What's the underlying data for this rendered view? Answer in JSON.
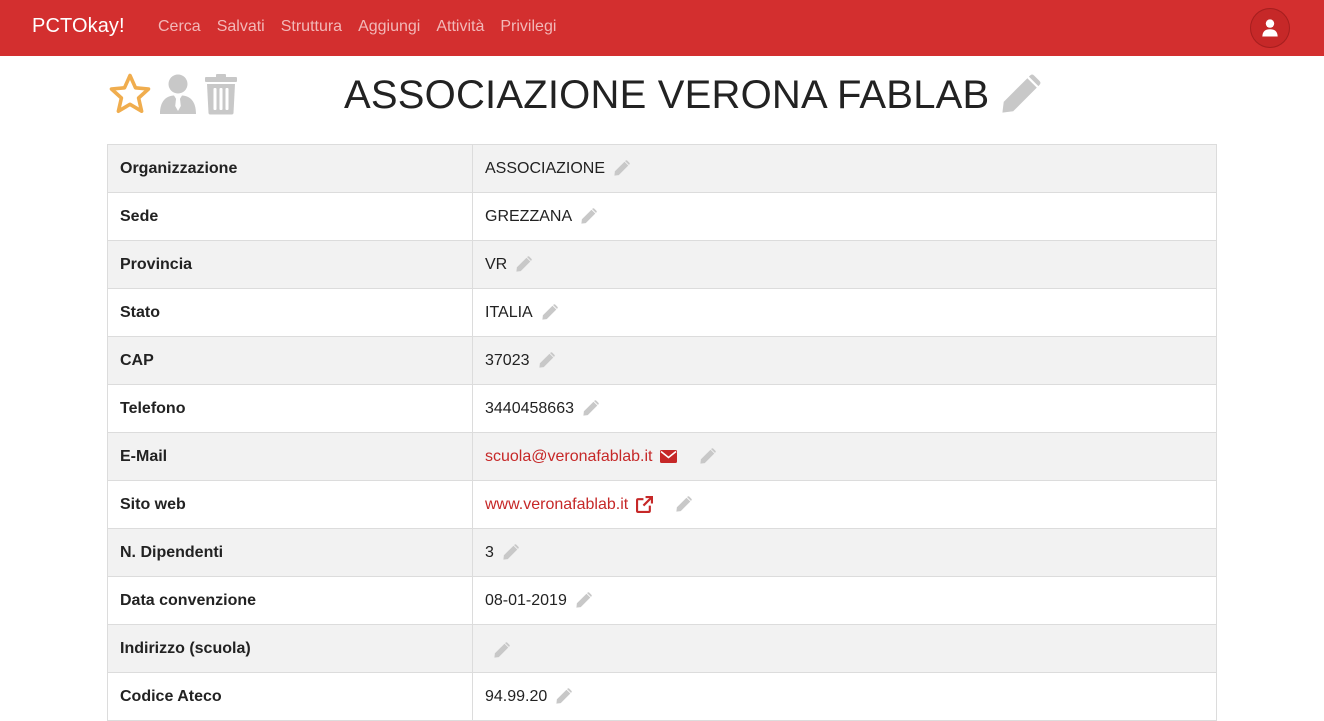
{
  "navbar": {
    "brand": "PCTOkay!",
    "items": [
      {
        "label": "Cerca"
      },
      {
        "label": "Salvati"
      },
      {
        "label": "Struttura"
      },
      {
        "label": "Aggiungi"
      },
      {
        "label": "Attività"
      },
      {
        "label": "Privilegi"
      }
    ],
    "user_icon": "user-icon"
  },
  "toolbar": {
    "icons": [
      "star-outline-icon",
      "user-tie-icon",
      "trash-icon"
    ]
  },
  "page": {
    "title": "ASSOCIAZIONE VERONA FABLAB",
    "title_edit_icon": "pencil-icon"
  },
  "details": [
    {
      "label": "Organizzazione",
      "value": "ASSOCIAZIONE"
    },
    {
      "label": "Sede",
      "value": "GREZZANA"
    },
    {
      "label": "Provincia",
      "value": "VR"
    },
    {
      "label": "Stato",
      "value": "ITALIA"
    },
    {
      "label": "CAP",
      "value": "37023"
    },
    {
      "label": "Telefono",
      "value": "3440458663"
    },
    {
      "label": "E-Mail",
      "value": "scuola@veronafablab.it",
      "extra_icon": "envelope-icon"
    },
    {
      "label": "Sito web",
      "value": "www.veronafablab.it",
      "extra_icon": "external-link-icon"
    },
    {
      "label": "N. Dipendenti",
      "value": "3"
    },
    {
      "label": "Data convenzione",
      "value": "08-01-2019"
    },
    {
      "label": "Indirizzo (scuola)",
      "value": ""
    },
    {
      "label": "Codice Ateco",
      "value": "94.99.20"
    }
  ],
  "colors": {
    "navbar_bg": "#d32f2f",
    "link": "#c62828",
    "star": "#f0ad4e",
    "muted_icon": "#c8c8c8",
    "row_stripe": "#f2f2f2"
  }
}
